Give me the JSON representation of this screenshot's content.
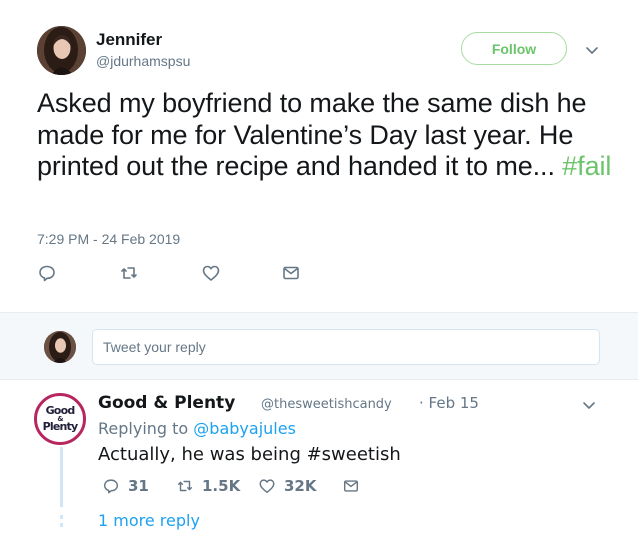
{
  "tweet": {
    "name": "Jennifer",
    "handle": "@jdurhamspsu",
    "follow_label": "Follow",
    "text_main": "Asked my boyfriend to make the same dish he made for me for Valentine’s Day last year. He printed out the recipe and handed it to me... ",
    "hashtag": "#fail",
    "timestamp": "7:29 PM - 24 Feb 2019"
  },
  "reply_box": {
    "placeholder": "Tweet your reply"
  },
  "reply": {
    "avatar_line1": "Good",
    "avatar_amp": "&",
    "avatar_line2": "Plenty",
    "name": "Good & Plenty",
    "handle": "@thesweetishcandy",
    "date": "· Feb 15",
    "replying_prefix": "Replying to ",
    "replying_mention": "@babyajules",
    "text": "Actually, he was being #sweetish",
    "reply_count": "31",
    "retweet_count": "1.5K",
    "like_count": "32K",
    "more_replies": "1 more reply"
  },
  "colors": {
    "text": "#14171a",
    "muted": "#657786",
    "link": "#1da1f2",
    "hashtag": "#6bc469",
    "follow_border": "#a6dca0",
    "brand_ring": "#b6275f"
  },
  "icons": [
    "reply-icon",
    "retweet-icon",
    "like-icon",
    "message-icon",
    "chevron-down-icon"
  ]
}
